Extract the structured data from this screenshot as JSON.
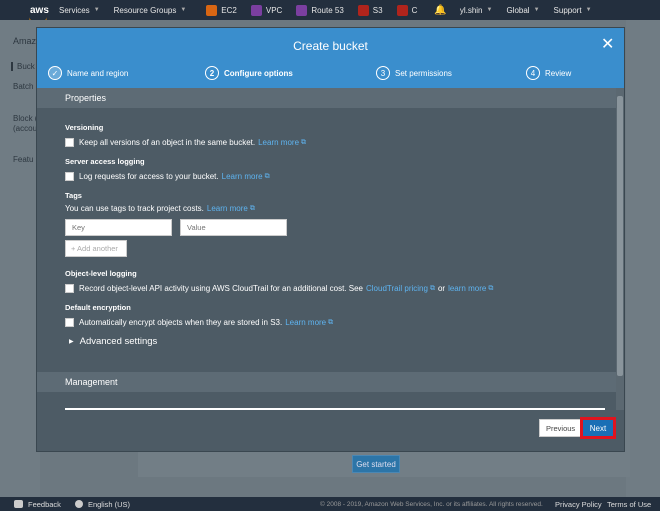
{
  "topnav": {
    "logo": "aws",
    "services": "Services",
    "resource_groups": "Resource Groups",
    "shortcuts": [
      "EC2",
      "VPC",
      "Route 53",
      "S3",
      "C"
    ],
    "user": "yl.shin",
    "region": "Global",
    "support": "Support"
  },
  "sidebar": {
    "items": [
      "Amaz",
      "Buck",
      "Batch",
      "Block (",
      "(accou",
      "Featu"
    ]
  },
  "modal": {
    "title": "Create bucket",
    "steps": [
      {
        "number": "✓",
        "label": "Name and region"
      },
      {
        "number": "2",
        "label": "Configure options"
      },
      {
        "number": "3",
        "label": "Set permissions"
      },
      {
        "number": "4",
        "label": "Review"
      }
    ],
    "properties_header": "Properties",
    "versioning": {
      "title": "Versioning",
      "label": "Keep all versions of an object in the same bucket.",
      "link": "Learn more"
    },
    "server_access_logging": {
      "title": "Server access logging",
      "label": "Log requests for access to your bucket.",
      "link": "Learn more"
    },
    "tags": {
      "title": "Tags",
      "description": "You can use tags to track project costs.",
      "link": "Learn more",
      "key_placeholder": "Key",
      "value_placeholder": "Value",
      "add_another": "+ Add another"
    },
    "object_level_logging": {
      "title": "Object-level logging",
      "label": "Record object-level API activity using AWS CloudTrail for an additional cost. See",
      "link1": "CloudTrail pricing",
      "or": "or",
      "link2": "learn more"
    },
    "default_encryption": {
      "title": "Default encryption",
      "label": "Automatically encrypt objects when they are stored in S3.",
      "link": "Learn more"
    },
    "advanced_settings": "Advanced settings",
    "management_header": "Management",
    "previous": "Previous",
    "next": "Next"
  },
  "page": {
    "get_started": "Get started"
  },
  "footer": {
    "feedback": "Feedback",
    "language": "English (US)",
    "copyright": "© 2008 - 2019, Amazon Web Services, Inc. or its affiliates. All rights reserved.",
    "privacy": "Privacy Policy",
    "terms": "Terms of Use"
  }
}
